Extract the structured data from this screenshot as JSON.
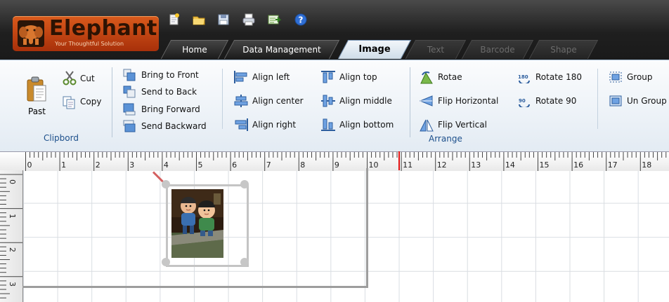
{
  "app": {
    "logo_name": "Elephant",
    "logo_tagline": "Your Thoughtful Solution",
    "brand_color": "#c8461a"
  },
  "quick_access": [
    {
      "icon": "new-document-icon"
    },
    {
      "icon": "open-folder-icon"
    },
    {
      "icon": "save-icon"
    },
    {
      "icon": "print-icon"
    },
    {
      "icon": "export-icon"
    },
    {
      "icon": "help-icon"
    }
  ],
  "tabs": [
    {
      "label": "Home",
      "state": "normal"
    },
    {
      "label": "Data Management",
      "state": "normal"
    },
    {
      "label": "Image",
      "state": "active"
    },
    {
      "label": "Text",
      "state": "disabled"
    },
    {
      "label": "Barcode",
      "state": "disabled"
    },
    {
      "label": "Shape",
      "state": "disabled"
    }
  ],
  "ribbon": {
    "clipboard": {
      "label": "Clipbord",
      "paste": "Past",
      "cut": "Cut",
      "copy": "Copy"
    },
    "order": {
      "bring_to_front": "Bring to Front",
      "send_to_back": "Send to Back",
      "bring_forward": "Bring Forward",
      "send_backward": "Send Backward"
    },
    "align": {
      "left": "Align left",
      "center": "Align center",
      "right": "Align right",
      "top": "Align top",
      "middle": "Align middle",
      "bottom": "Align bottom"
    },
    "arrange": {
      "label": "Arrange",
      "rotate": "Rotae",
      "flip_horizontal": "Flip Horizontal",
      "flip_vertical": "Flip Vertical",
      "rotate_180": "Rotate 180",
      "rotate_90": "Rotate 90"
    },
    "group": {
      "group": "Group",
      "ungroup": "Un Group"
    }
  },
  "ruler": {
    "h_numbers": [
      "0",
      "1",
      "2",
      "3",
      "4",
      "5",
      "6",
      "7",
      "8",
      "9",
      "10",
      "11",
      "12",
      "13",
      "14",
      "15",
      "16",
      "17",
      "18"
    ],
    "v_numbers": [
      "0",
      "1",
      "2",
      "3"
    ],
    "marker_color": "#e11111"
  }
}
